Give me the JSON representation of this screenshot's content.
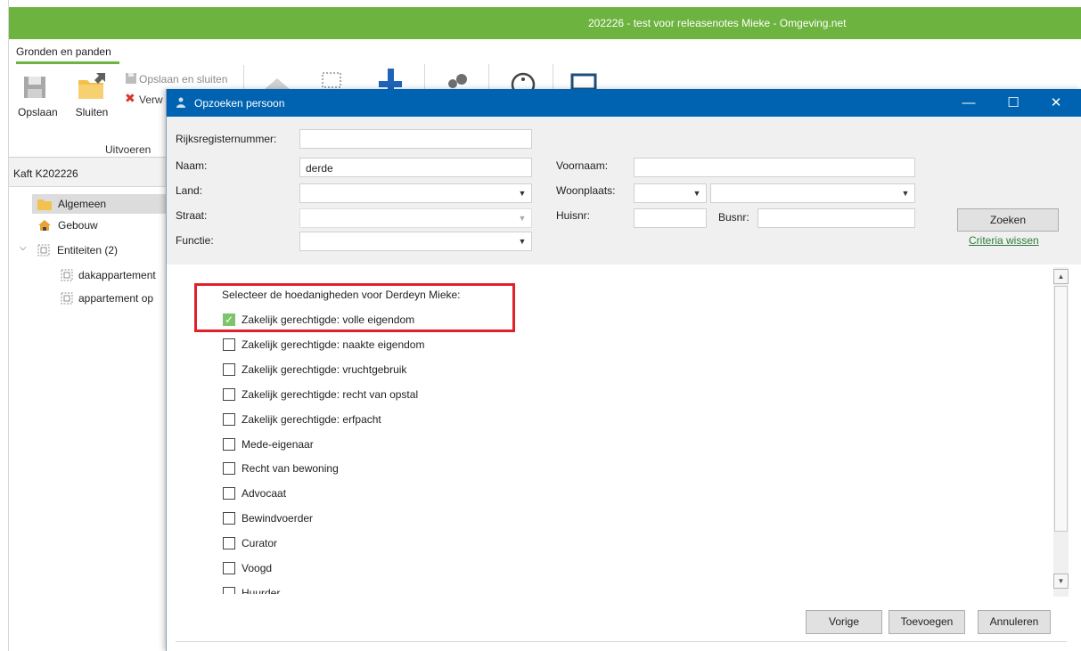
{
  "app": {
    "title": "202226 - test voor releasenotes Mieke - Omgeving.net",
    "ribbon_tab": "Gronden en panden",
    "buttons": {
      "opslaan": "Opslaan",
      "sluiten": "Sluiten",
      "opslaan_en_sluiten": "Opslaan en sluiten",
      "verwijderen_partial": "Verw"
    },
    "group_label": "Uitvoeren",
    "tree": {
      "header": "Kaft K202226",
      "items": [
        {
          "label": "Algemeen"
        },
        {
          "label": "Gebouw"
        },
        {
          "label": "Entiteiten (2)"
        },
        {
          "label": "dakappartement"
        },
        {
          "label": "appartement op"
        }
      ]
    },
    "accent_color": "#6db33f"
  },
  "dialog": {
    "title": "Opzoeken persoon",
    "titlebar_color": "#0063b1",
    "controls": {
      "minimize": "—",
      "maximize": "☐",
      "close": "✕"
    },
    "fields": {
      "rijksregisternummer": {
        "label": "Rijksregisternummer:",
        "value": ""
      },
      "naam": {
        "label": "Naam:",
        "value": "derde"
      },
      "voornaam": {
        "label": "Voornaam:",
        "value": ""
      },
      "land": {
        "label": "Land:",
        "value": ""
      },
      "woonplaats": {
        "label": "Woonplaats:",
        "value": ""
      },
      "straat": {
        "label": "Straat:",
        "value": ""
      },
      "huisnr": {
        "label": "Huisnr:",
        "value": ""
      },
      "busnr": {
        "label": "Busnr:",
        "value": ""
      },
      "functie": {
        "label": "Functie:",
        "value": ""
      }
    },
    "zoeken_button": "Zoeken",
    "criteria_wissen_link": "Criteria wissen",
    "list": {
      "heading": "Selecteer de hoedanigheden voor Derdeyn Mieke:",
      "options": [
        {
          "label": "Zakelijk gerechtigde: volle eigendom",
          "checked": true
        },
        {
          "label": "Zakelijk gerechtigde: naakte eigendom",
          "checked": false
        },
        {
          "label": "Zakelijk gerechtigde: vruchtgebruik",
          "checked": false
        },
        {
          "label": "Zakelijk gerechtigde: recht van opstal",
          "checked": false
        },
        {
          "label": "Zakelijk gerechtigde: erfpacht",
          "checked": false
        },
        {
          "label": "Mede-eigenaar",
          "checked": false
        },
        {
          "label": "Recht van bewoning",
          "checked": false
        },
        {
          "label": "Advocaat",
          "checked": false
        },
        {
          "label": "Bewindvoerder",
          "checked": false
        },
        {
          "label": "Curator",
          "checked": false
        },
        {
          "label": "Voogd",
          "checked": false
        },
        {
          "label": "Huurder",
          "checked": false
        }
      ]
    },
    "footer_buttons": {
      "vorige": "Vorige",
      "toevoegen": "Toevoegen",
      "annuleren": "Annuleren"
    },
    "highlight_color": "#e0202a"
  }
}
